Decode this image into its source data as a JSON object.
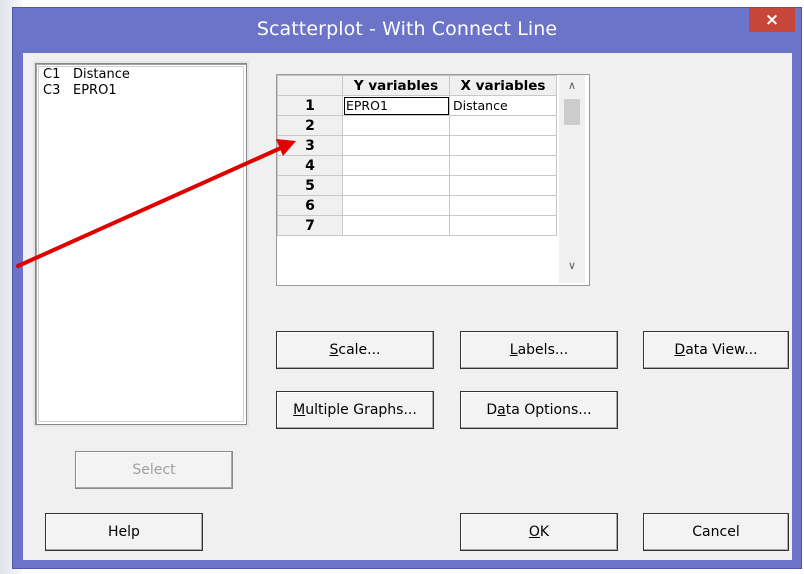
{
  "window": {
    "title": "Scatterplot - With Connect Line",
    "close_glyph": "×"
  },
  "variables": [
    {
      "col": "C1",
      "name": "Distance"
    },
    {
      "col": "C3",
      "name": "EPRO1"
    }
  ],
  "grid": {
    "headers": {
      "y": "Y variables",
      "x": "X variables"
    },
    "rows": [
      {
        "num": "1",
        "y": "EPRO1",
        "x": "Distance"
      },
      {
        "num": "2",
        "y": "",
        "x": ""
      },
      {
        "num": "3",
        "y": "",
        "x": ""
      },
      {
        "num": "4",
        "y": "",
        "x": ""
      },
      {
        "num": "5",
        "y": "",
        "x": ""
      },
      {
        "num": "6",
        "y": "",
        "x": ""
      },
      {
        "num": "7",
        "y": "",
        "x": ""
      }
    ],
    "scroll_up": "∧",
    "scroll_down": "∨"
  },
  "buttons": {
    "scale": {
      "pre": "",
      "mnemonic": "S",
      "post": "cale..."
    },
    "labels": {
      "pre": "",
      "mnemonic": "L",
      "post": "abels..."
    },
    "data_view": {
      "pre": "",
      "mnemonic": "D",
      "post": "ata View..."
    },
    "multiple_graphs": {
      "pre": "",
      "mnemonic": "M",
      "post": "ultiple Graphs..."
    },
    "data_options": {
      "pre": "D",
      "mnemonic": "a",
      "post": "ta Options..."
    },
    "select": "Select",
    "help": "Help",
    "ok": {
      "pre": "",
      "mnemonic": "O",
      "post": "K"
    },
    "cancel": "Cancel"
  },
  "colors": {
    "titlebar": "#6b74c9",
    "close": "#c7463a",
    "annotation_arrow": "#e00000"
  },
  "annotation": {
    "type": "arrow",
    "points_to": "grid row 2"
  }
}
